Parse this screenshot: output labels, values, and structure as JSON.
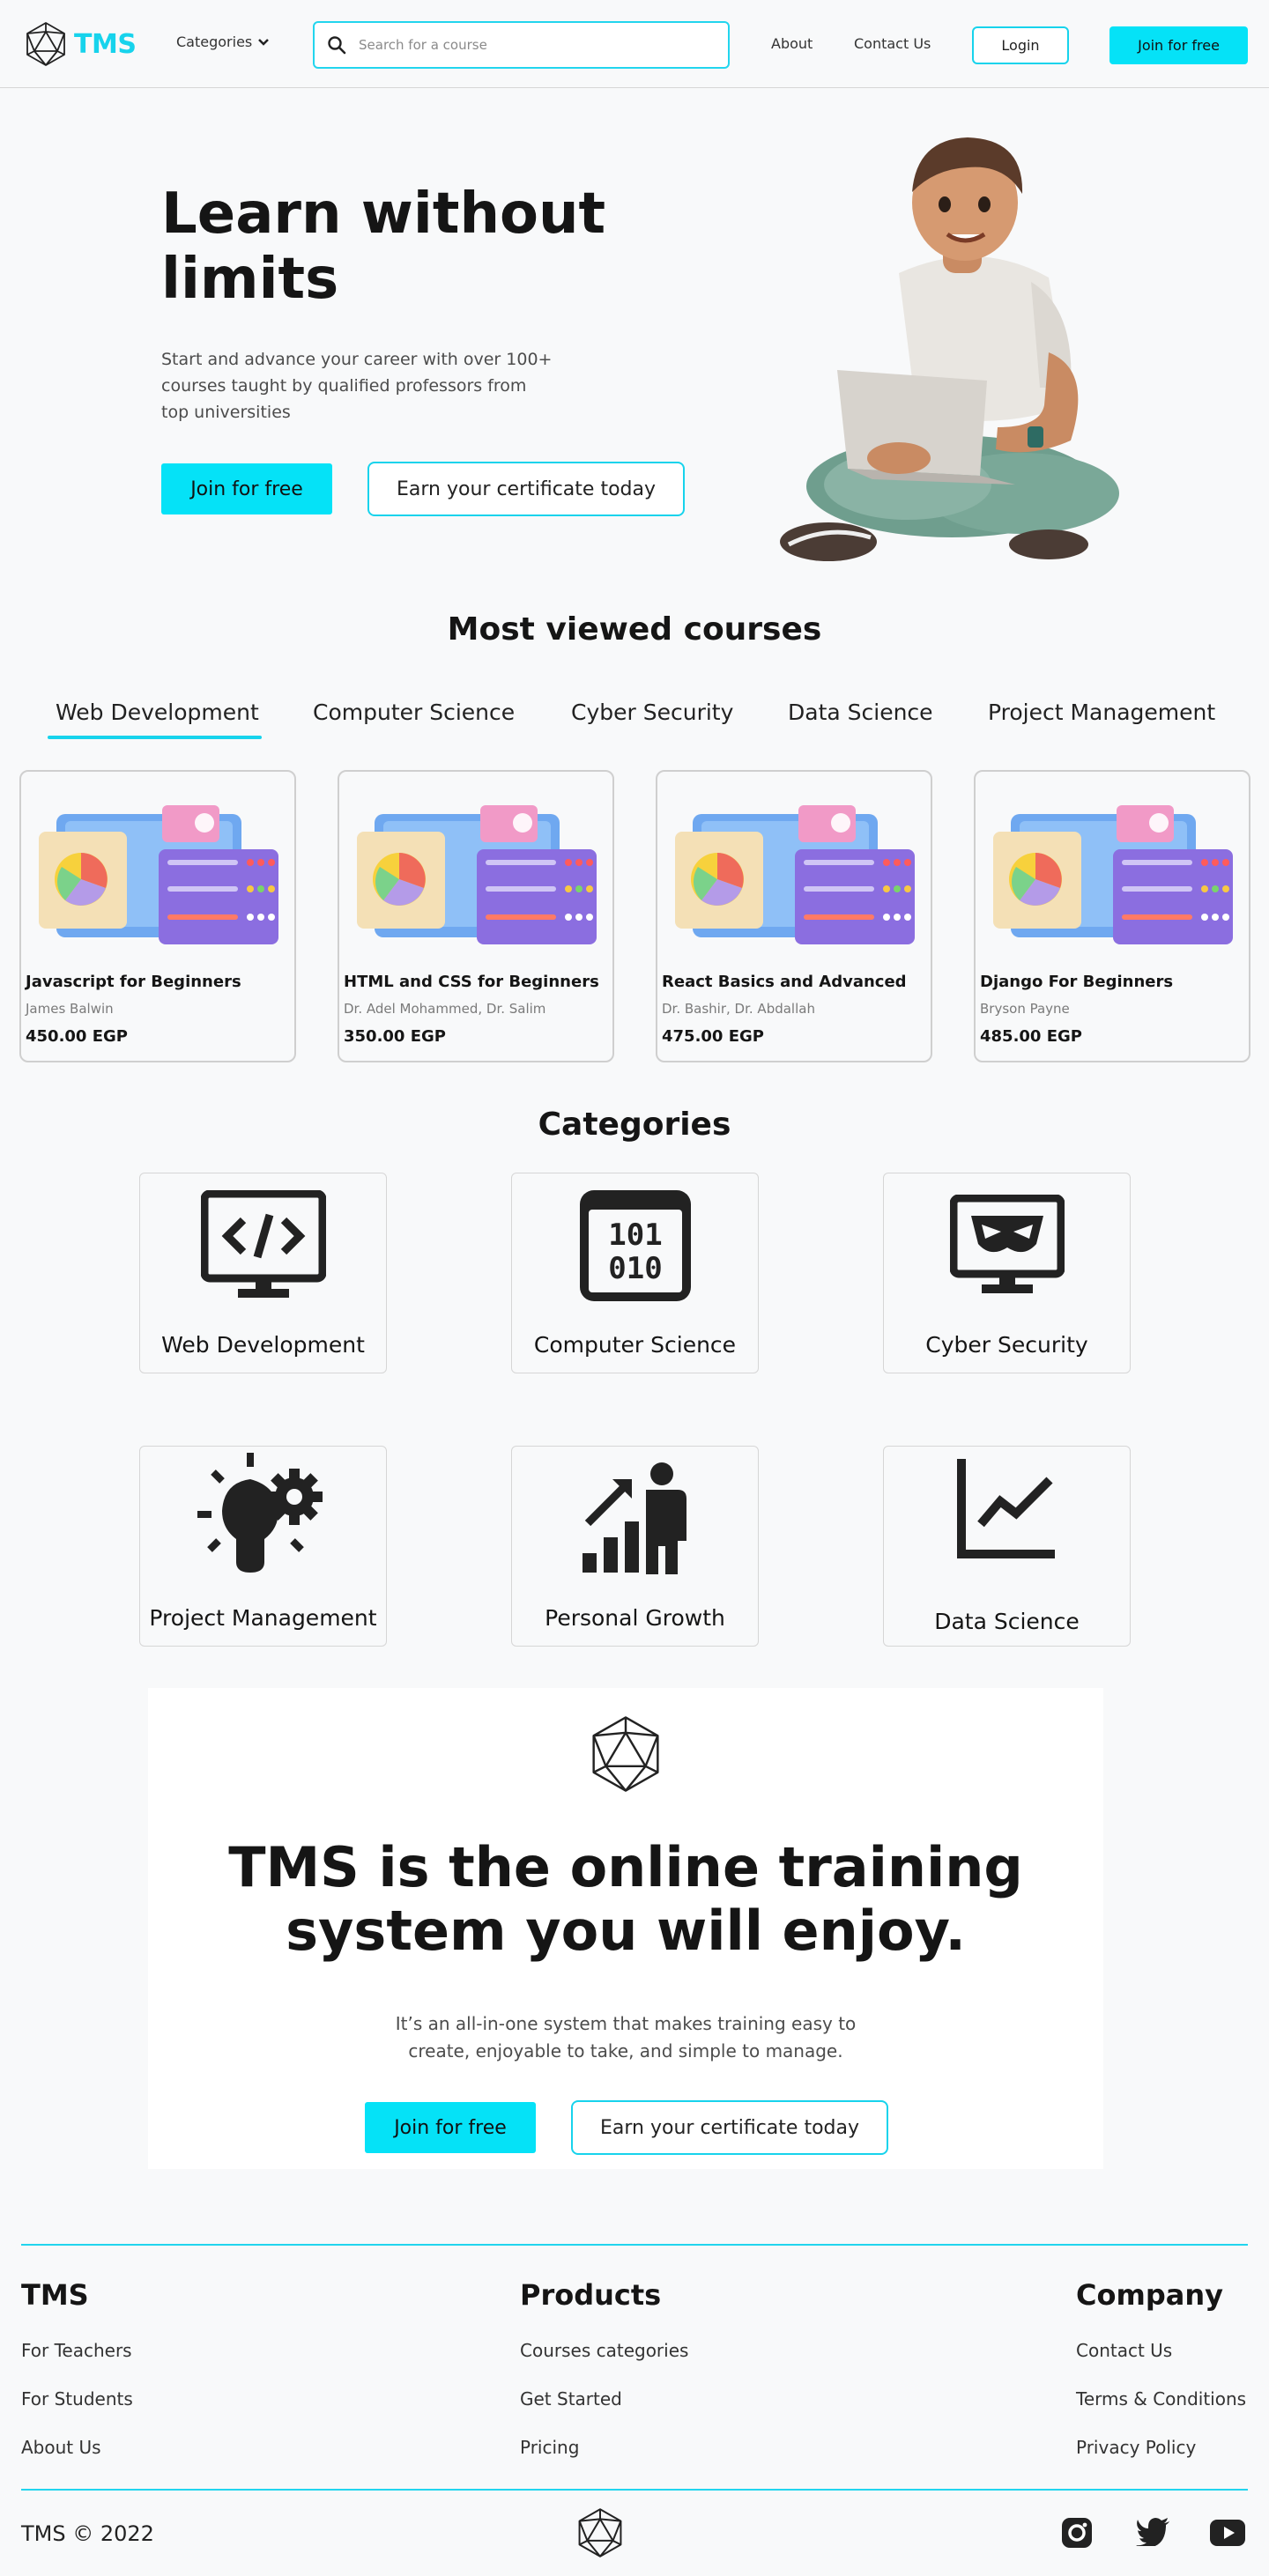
{
  "header": {
    "brand": "TMS",
    "categories_label": "Categories",
    "search_placeholder": "Search for a course",
    "about": "About",
    "contact": "Contact Us",
    "login": "Login",
    "join": "Join for free"
  },
  "hero": {
    "title_line1": "Learn without",
    "title_line2": "limits",
    "subtitle": "Start and advance your career with over 100+ courses taught by qualified professors from top universities",
    "join_button": "Join for free",
    "certificate_button": "Earn your certificate today"
  },
  "most_viewed": {
    "title": "Most viewed courses",
    "tabs": [
      "Web Development",
      "Computer Science",
      "Cyber Security",
      "Data Science",
      "Project Management"
    ],
    "active_tab": "Web Development",
    "courses": [
      {
        "title": "Javascript for Beginners",
        "author": "James Balwin",
        "price": "450.00 EGP"
      },
      {
        "title": "HTML and CSS for Beginners",
        "author": "Dr. Adel Mohammed, Dr. Salim",
        "price": "350.00 EGP"
      },
      {
        "title": "React Basics and Advanced",
        "author": "Dr. Bashir, Dr. Abdallah",
        "price": "475.00 EGP"
      },
      {
        "title": "Django For Beginners",
        "author": "Bryson Payne",
        "price": "485.00 EGP"
      }
    ]
  },
  "categories": {
    "title": "Categories",
    "items": [
      {
        "label": "Web Development",
        "icon": "code-monitor-icon"
      },
      {
        "label": "Computer Science",
        "icon": "binary-chip-icon"
      },
      {
        "label": "Cyber Security",
        "icon": "hacker-monitor-icon"
      },
      {
        "label": "Project Management",
        "icon": "lightbulb-gear-icon"
      },
      {
        "label": "Personal Growth",
        "icon": "growth-person-icon"
      },
      {
        "label": "Data Science",
        "icon": "line-chart-icon"
      }
    ],
    "binary_top": "101",
    "binary_bottom": "010"
  },
  "promo": {
    "title_line1": "TMS is the online training",
    "title_line2": "system you will enjoy.",
    "subtitle_line1": "It’s an all-in-one system that makes training easy to",
    "subtitle_line2": "create, enjoyable to take, and simple to manage.",
    "join_button": "Join for free",
    "certificate_button": "Earn your certificate today"
  },
  "footer": {
    "col1": {
      "title": "TMS",
      "links": [
        "For Teachers",
        "For  Students",
        "About Us"
      ]
    },
    "col2": {
      "title": "Products",
      "links": [
        "Courses categories",
        "Get Started",
        "Pricing"
      ]
    },
    "col3": {
      "title": "Company",
      "links": [
        "Contact Us",
        "Terms & Conditions",
        "Privacy Policy"
      ]
    },
    "copyright": "TMS © 2022",
    "social": [
      "instagram-icon",
      "twitter-icon",
      "youtube-icon"
    ]
  },
  "colors": {
    "accent": "#05e2f7",
    "accent_border": "#17d3ec",
    "text": "#151515",
    "background": "#f8f9fa"
  }
}
